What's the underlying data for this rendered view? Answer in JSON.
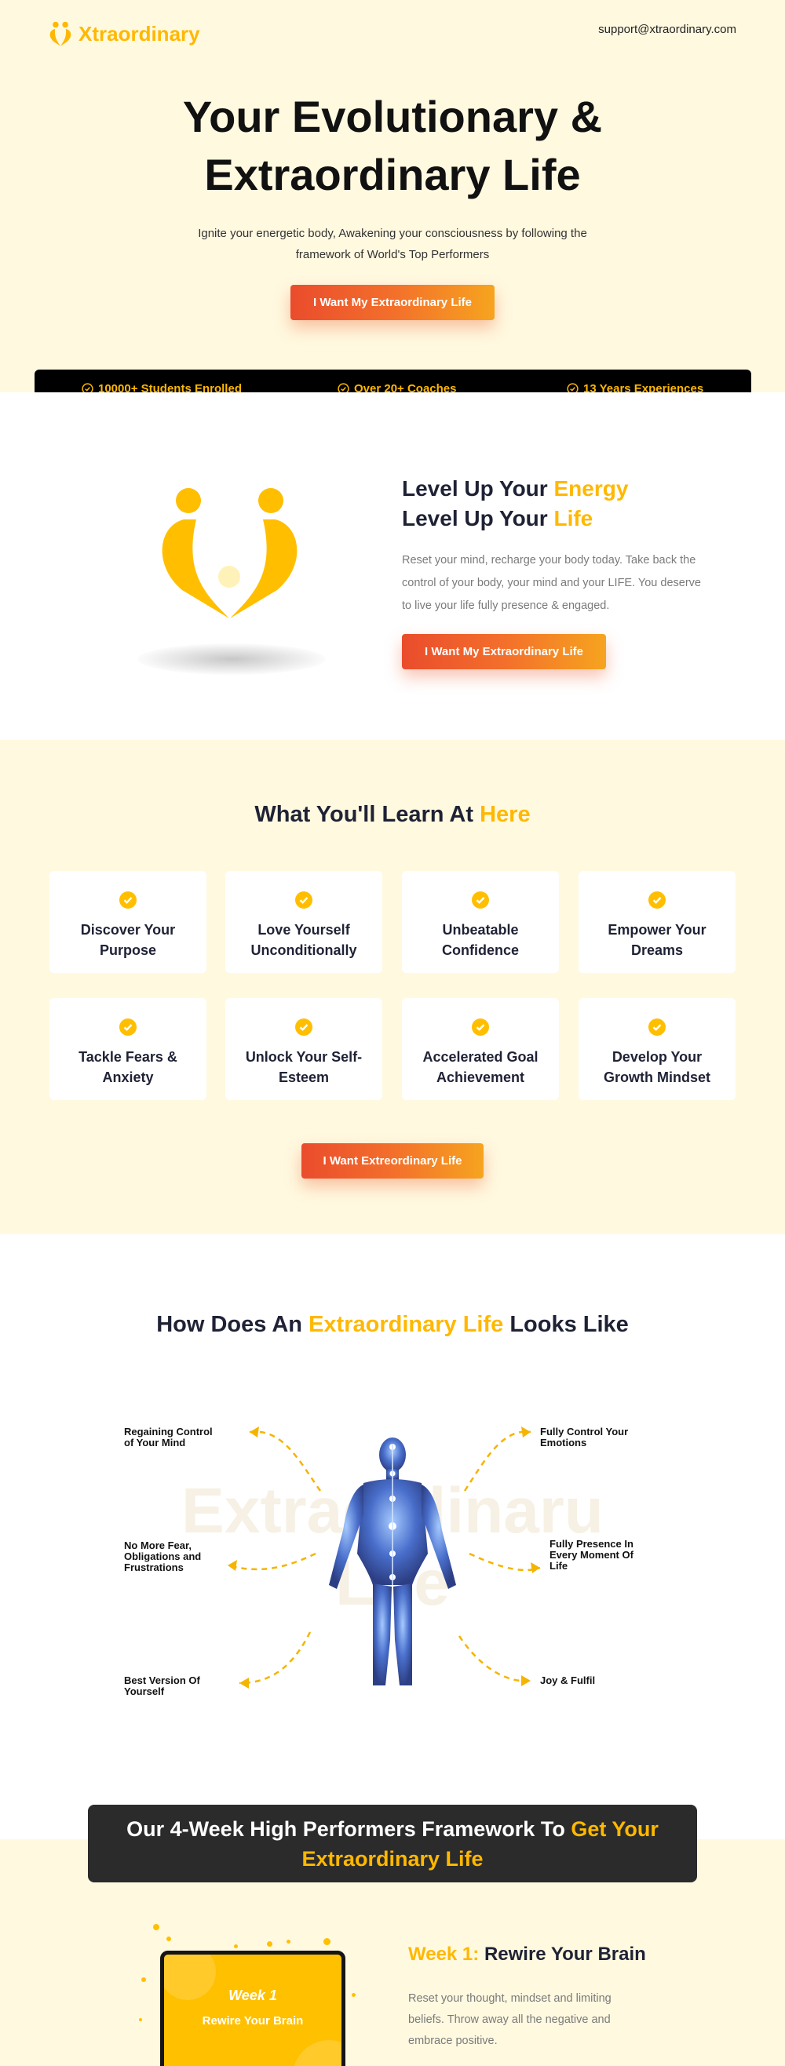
{
  "brand": {
    "name": "Xtraordinary",
    "email": "support@xtraordinary.com",
    "color": "#ffb800"
  },
  "hero": {
    "title_line1": "Your Evolutionary &",
    "title_line2": "Extraordinary Life",
    "subtitle_line1": "Ignite your energetic body, Awakening your consciousness by following the",
    "subtitle_line2": "framework of World's Top Performers",
    "cta": "I Want My Extraordinary Life"
  },
  "stats": [
    {
      "icon": "check-circle-icon",
      "label": "10000+ Students Enrolled"
    },
    {
      "icon": "check-circle-icon",
      "label": "Over 20+ Coaches"
    },
    {
      "icon": "check-circle-icon",
      "label": "13 Years Experiences"
    }
  ],
  "levelup": {
    "line1_prefix": "Level Up Your ",
    "line1_highlight": "Energy",
    "line2_prefix": "Level Up Your ",
    "line2_highlight": "Life",
    "description": "Reset your mind, recharge your body today. Take back the control of your body, your mind and your LIFE. You deserve to live your life fully presence & engaged.",
    "cta": "I Want My Extraordinary Life"
  },
  "learn": {
    "title_prefix": "What You'll Learn At ",
    "title_highlight": "Here",
    "items": [
      {
        "line1": "Discover Your",
        "line2": "Purpose"
      },
      {
        "line1": "Love Yourself",
        "line2": "Unconditionally"
      },
      {
        "line1": "Unbeatable",
        "line2": "Confidence"
      },
      {
        "line1": "Empower Your",
        "line2": "Dreams"
      },
      {
        "line1": "Tackle Fears &",
        "line2": "Anxiety"
      },
      {
        "line1": "Unlock Your Self-",
        "line2": "Esteem"
      },
      {
        "line1": "Accelerated Goal",
        "line2": "Achievement"
      },
      {
        "line1": "Develop Your",
        "line2": "Growth Mindset"
      }
    ],
    "cta": "I Want Extreordinary Life"
  },
  "extraordinary": {
    "title_prefix": "How Does An ",
    "title_highlight": "Extraordinary Life",
    "title_suffix": " Looks Like",
    "watermark_line1": "Extraordinaru",
    "watermark_line2": "Life",
    "benefits": {
      "b1a": "Regaining Control",
      "b1b": "of Your Mind",
      "b2a": "Fully Control Your",
      "b2b": "Emotions",
      "b3a": "No More Fear,",
      "b3b": "Obligations and",
      "b3c": "Frustrations",
      "b4a": "Fully Presence In",
      "b4b": "Every Moment Of",
      "b4c": "Life",
      "b5a": "Best Version Of",
      "b5b": "Yourself",
      "b6a": "Joy & Fulfil"
    }
  },
  "framework": {
    "banner_prefix": "Our 4-Week High Performers Framework To ",
    "banner_highlight1": "Get Your",
    "banner_highlight2": "Extraordinary Life",
    "week_card_number": "Week 1",
    "week_card_label": "Rewire Your Brain",
    "week_title_prefix": "Week 1:",
    "week_title": " Rewire Your Brain",
    "week_desc_line1": "Reset your thought, mindset and limiting",
    "week_desc_line2": "beliefs. Throw away all the negative and",
    "week_desc_line3": "embrace positive."
  }
}
